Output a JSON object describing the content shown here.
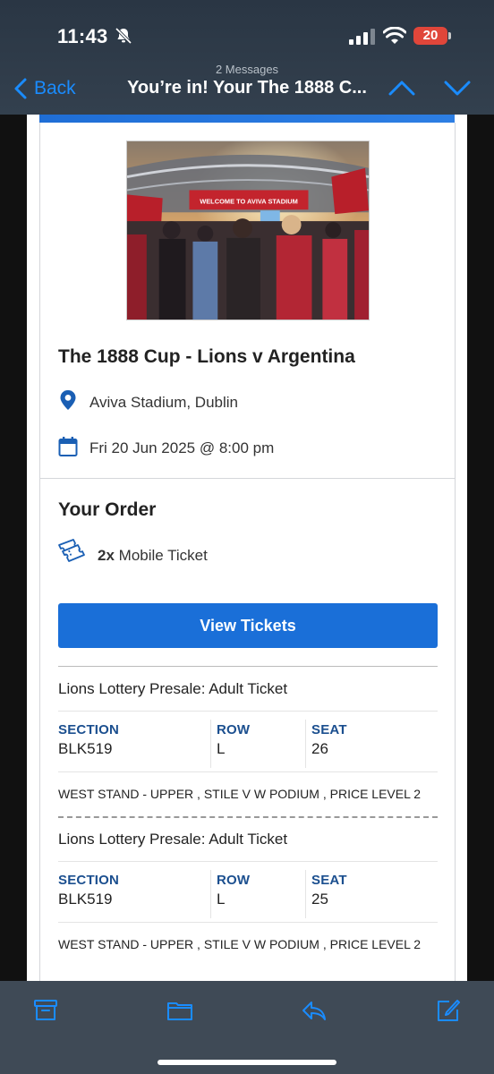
{
  "status_bar": {
    "time": "11:43",
    "battery": "20",
    "battery_color": "#e0463a"
  },
  "nav": {
    "back_label": "Back",
    "subtitle": "2 Messages",
    "title": "You’re in! Your The 1888 C...",
    "accent_color": "#1a8cff"
  },
  "event": {
    "hero_banner_text": "WELCOME TO AVIVA STADIUM",
    "title": "The 1888 Cup - Lions v Argentina",
    "venue": "Aviva Stadium, Dublin",
    "date": "Fri 20 Jun 2025 @ 8:00 pm"
  },
  "order": {
    "heading": "Your Order",
    "quantity": "2x",
    "ticket_type": "Mobile Ticket",
    "view_button": "View Tickets",
    "button_color": "#1a6fd8"
  },
  "tickets": [
    {
      "name": "Lions Lottery Presale: Adult Ticket",
      "section_label": "SECTION",
      "section": "BLK519",
      "row_label": "ROW",
      "row": "L",
      "seat_label": "SEAT",
      "seat": "26",
      "description": "WEST STAND - UPPER , STILE V W PODIUM , PRICE LEVEL 2"
    },
    {
      "name": "Lions Lottery Presale: Adult Ticket",
      "section_label": "SECTION",
      "section": "BLK519",
      "row_label": "ROW",
      "row": "L",
      "seat_label": "SEAT",
      "seat": "25",
      "description": "WEST STAND - UPPER , STILE V W PODIUM , PRICE LEVEL 2"
    }
  ],
  "toolbar": {
    "icons": [
      "archive-icon",
      "folder-icon",
      "reply-icon",
      "compose-icon"
    ],
    "icon_color": "#1a8cff"
  }
}
